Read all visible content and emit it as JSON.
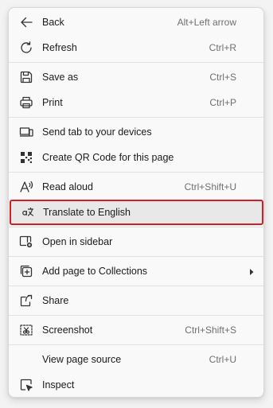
{
  "menu": {
    "items": [
      {
        "label": "Back",
        "shortcut": "Alt+Left arrow",
        "icon": "back-arrow-icon"
      },
      {
        "label": "Refresh",
        "shortcut": "Ctrl+R",
        "icon": "refresh-icon"
      },
      {
        "label": "Save as",
        "shortcut": "Ctrl+S",
        "icon": "save-icon"
      },
      {
        "label": "Print",
        "shortcut": "Ctrl+P",
        "icon": "print-icon"
      },
      {
        "label": "Send tab to your devices",
        "shortcut": "",
        "icon": "send-to-device-icon"
      },
      {
        "label": "Create QR Code for this page",
        "shortcut": "",
        "icon": "qr-code-icon"
      },
      {
        "label": "Read aloud",
        "shortcut": "Ctrl+Shift+U",
        "icon": "read-aloud-icon"
      },
      {
        "label": "Translate to English",
        "shortcut": "",
        "icon": "translate-icon",
        "highlighted": true
      },
      {
        "label": "Open in sidebar",
        "shortcut": "",
        "icon": "sidebar-icon"
      },
      {
        "label": "Add page to Collections",
        "shortcut": "",
        "icon": "collections-icon",
        "submenu": true
      },
      {
        "label": "Share",
        "shortcut": "",
        "icon": "share-icon"
      },
      {
        "label": "Screenshot",
        "shortcut": "Ctrl+Shift+S",
        "icon": "screenshot-icon"
      },
      {
        "label": "View page source",
        "shortcut": "Ctrl+U",
        "icon": ""
      },
      {
        "label": "Inspect",
        "shortcut": "",
        "icon": "inspect-icon"
      }
    ]
  },
  "colors": {
    "highlight_border": "#d01f26",
    "highlight_background": "#e8e8e8",
    "menu_background": "#f9f9f9",
    "shortcut_text": "#707070"
  }
}
